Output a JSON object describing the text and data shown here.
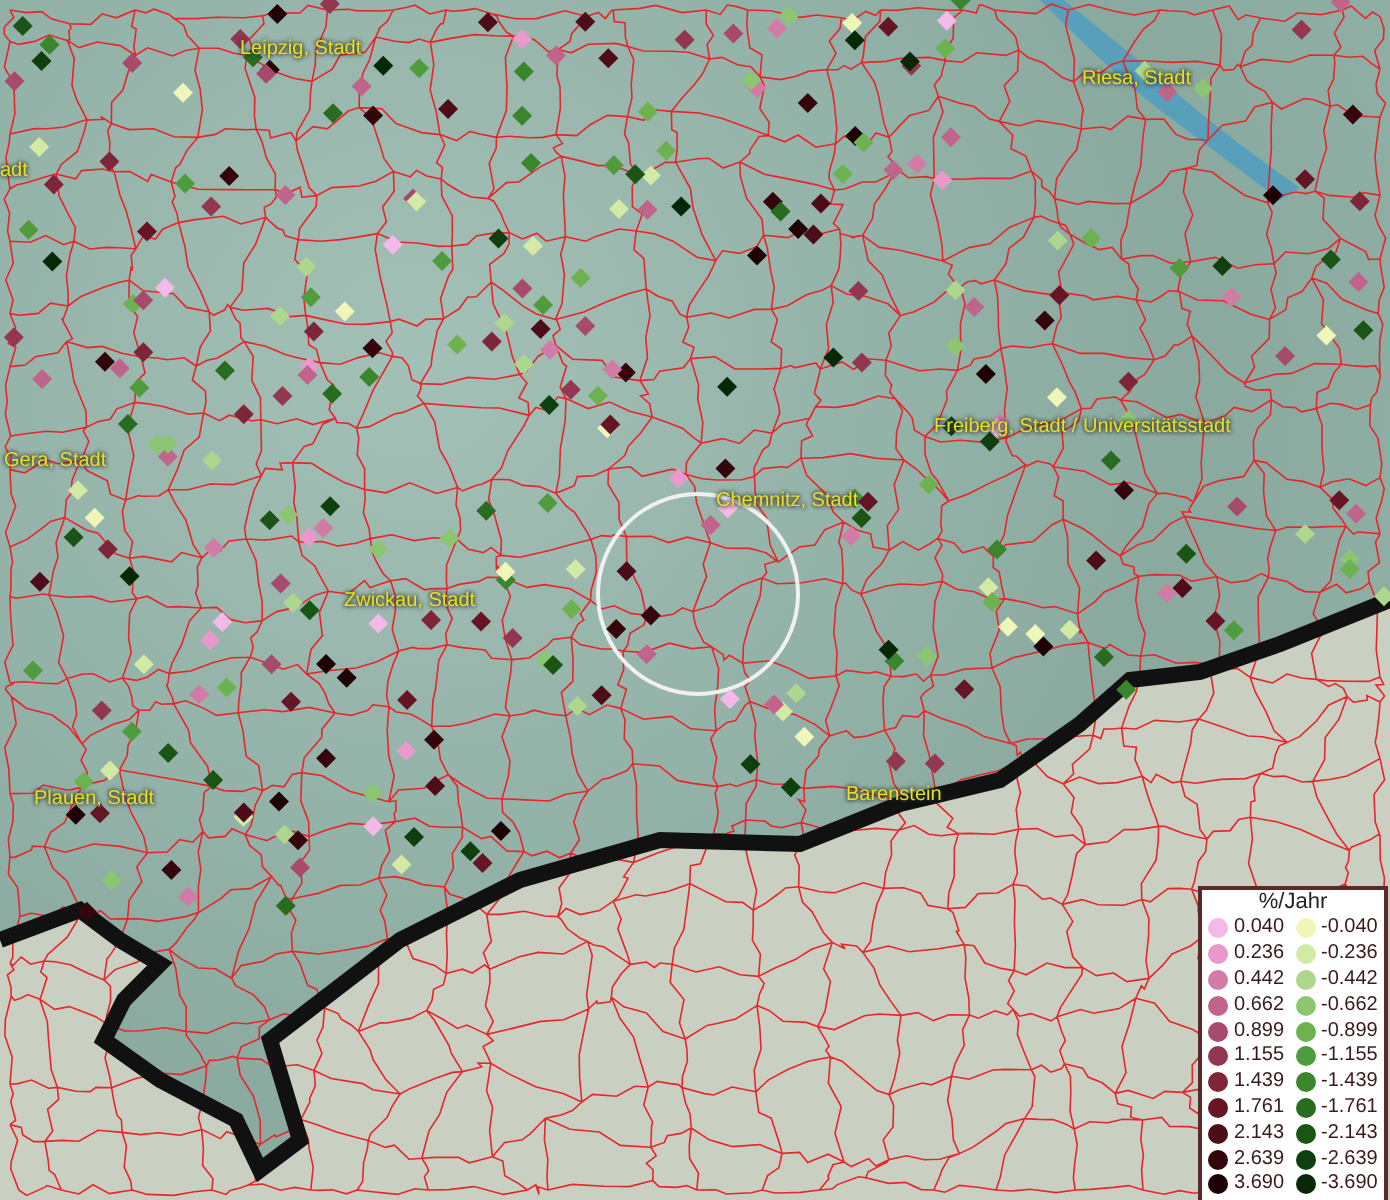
{
  "map": {
    "places": [
      {
        "name": "Leipzig, Stadt"
      },
      {
        "name": "adt"
      },
      {
        "name": "Riesa, Stadt"
      },
      {
        "name": "Freiberg, Stadt / Universitätsstadt"
      },
      {
        "name": "Gera, Stadt"
      },
      {
        "name": "Chemnitz, Stadt"
      },
      {
        "name": "Zwickau, Stadt"
      },
      {
        "name": "Plauen, Stadt"
      },
      {
        "name": "Barenstein"
      }
    ]
  },
  "legend": {
    "title": "%/Jahr",
    "rows": [
      {
        "positive": {
          "label": "0.040",
          "color": "#f4b9e8"
        },
        "negative": {
          "label": "-0.040",
          "color": "#f0f6b8"
        }
      },
      {
        "positive": {
          "label": "0.236",
          "color": "#e79acb"
        },
        "negative": {
          "label": "-0.236",
          "color": "#d2eaa4"
        }
      },
      {
        "positive": {
          "label": "0.442",
          "color": "#d27ba6"
        },
        "negative": {
          "label": "-0.442",
          "color": "#acd78c"
        }
      },
      {
        "positive": {
          "label": "0.662",
          "color": "#c0648b"
        },
        "negative": {
          "label": "-0.662",
          "color": "#8cc670"
        }
      },
      {
        "positive": {
          "label": "0.899",
          "color": "#a84a6c"
        },
        "negative": {
          "label": "-0.899",
          "color": "#6cb250"
        }
      },
      {
        "positive": {
          "label": "1.155",
          "color": "#93364f"
        },
        "negative": {
          "label": "-1.155",
          "color": "#4f9c3c"
        }
      },
      {
        "positive": {
          "label": "1.439",
          "color": "#7e2538"
        },
        "negative": {
          "label": "-1.439",
          "color": "#3a862c"
        }
      },
      {
        "positive": {
          "label": "1.761",
          "color": "#661525"
        },
        "negative": {
          "label": "-1.761",
          "color": "#286c20"
        }
      },
      {
        "positive": {
          "label": "2.143",
          "color": "#4d0c17"
        },
        "negative": {
          "label": "-2.143",
          "color": "#1a5516"
        }
      },
      {
        "positive": {
          "label": "2.639",
          "color": "#35050c"
        },
        "negative": {
          "label": "-2.639",
          "color": "#0f3f0e"
        }
      },
      {
        "positive": {
          "label": "3.690",
          "color": "#1e0105"
        },
        "negative": {
          "label": "-3.690",
          "color": "#072806"
        }
      }
    ]
  }
}
